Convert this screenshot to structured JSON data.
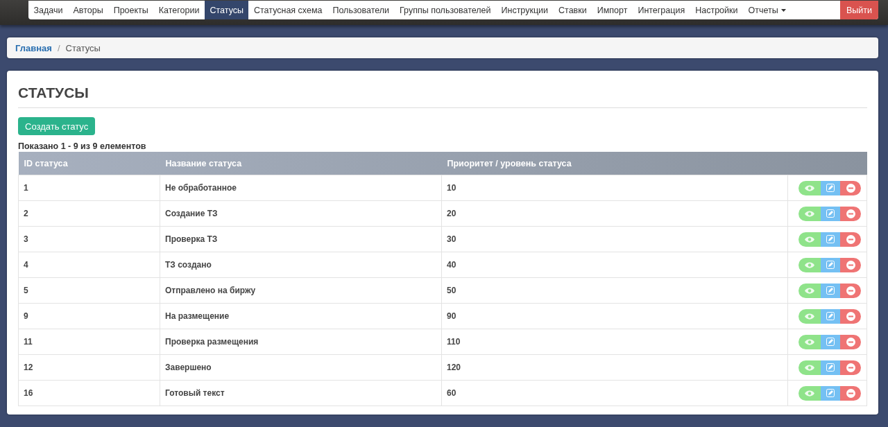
{
  "nav": [
    {
      "label": "Задачи",
      "selected": false,
      "kind": "link"
    },
    {
      "label": "Авторы",
      "selected": false,
      "kind": "link"
    },
    {
      "label": "Проекты",
      "selected": false,
      "kind": "link"
    },
    {
      "label": "Категории",
      "selected": false,
      "kind": "link"
    },
    {
      "label": "Статусы",
      "selected": true,
      "kind": "link"
    },
    {
      "label": "Статусная схема",
      "selected": false,
      "kind": "link"
    },
    {
      "label": "Пользователи",
      "selected": false,
      "kind": "link"
    },
    {
      "label": "Группы пользователей",
      "selected": false,
      "kind": "link"
    },
    {
      "label": "Инструкции",
      "selected": false,
      "kind": "link"
    },
    {
      "label": "Ставки",
      "selected": false,
      "kind": "link"
    },
    {
      "label": "Импорт",
      "selected": false,
      "kind": "link"
    },
    {
      "label": "Интеграция",
      "selected": false,
      "kind": "link"
    },
    {
      "label": "Настройки",
      "selected": false,
      "kind": "link"
    },
    {
      "label": "Отчеты",
      "selected": false,
      "kind": "dropdown"
    },
    {
      "label": "Выйти",
      "selected": false,
      "kind": "logout"
    }
  ],
  "breadcrumb": [
    {
      "label": "Главная",
      "kind": "link"
    },
    {
      "label": "/",
      "kind": "separator"
    },
    {
      "label": "Статусы",
      "kind": "current"
    }
  ],
  "page": {
    "title": "СТАТУСЫ",
    "create_button": "Создать статус",
    "summary": "Показано 1 - 9 из 9 елементов"
  },
  "table": {
    "columns": [
      "ID статуса",
      "Название статуса",
      "Приоритет / уровень статуса"
    ],
    "rows": [
      [
        "1",
        "Не обработанное",
        "10"
      ],
      [
        "2",
        "Создание ТЗ",
        "20"
      ],
      [
        "3",
        "Проверка ТЗ",
        "30"
      ],
      [
        "4",
        "ТЗ создано",
        "40"
      ],
      [
        "5",
        "Отправлено на биржу",
        "50"
      ],
      [
        "9",
        "На размещение",
        "90"
      ],
      [
        "11",
        "Проверка размещения",
        "110"
      ],
      [
        "12",
        "Завершено",
        "120"
      ],
      [
        "16",
        "Готовый текст",
        "60"
      ]
    ]
  }
}
